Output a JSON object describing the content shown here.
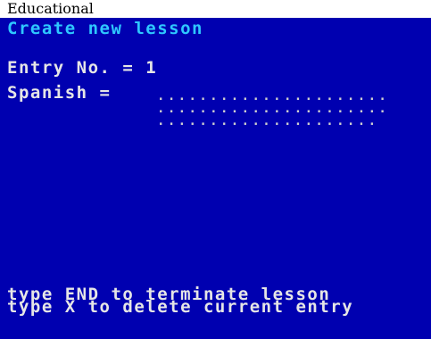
{
  "caption": "Educational",
  "screen": {
    "title": "Create new lesson",
    "entry_label": "Entry No. = 1",
    "language_label": "Spanish =",
    "input_rows": [
      "......................",
      "......................",
      "....................."
    ],
    "footer_line1": "type END to terminate lesson",
    "footer_line2": "type X to delete current entry"
  },
  "colors": {
    "background": "#0000b0",
    "title": "#2ec7ff",
    "text": "#e6e6e6"
  }
}
